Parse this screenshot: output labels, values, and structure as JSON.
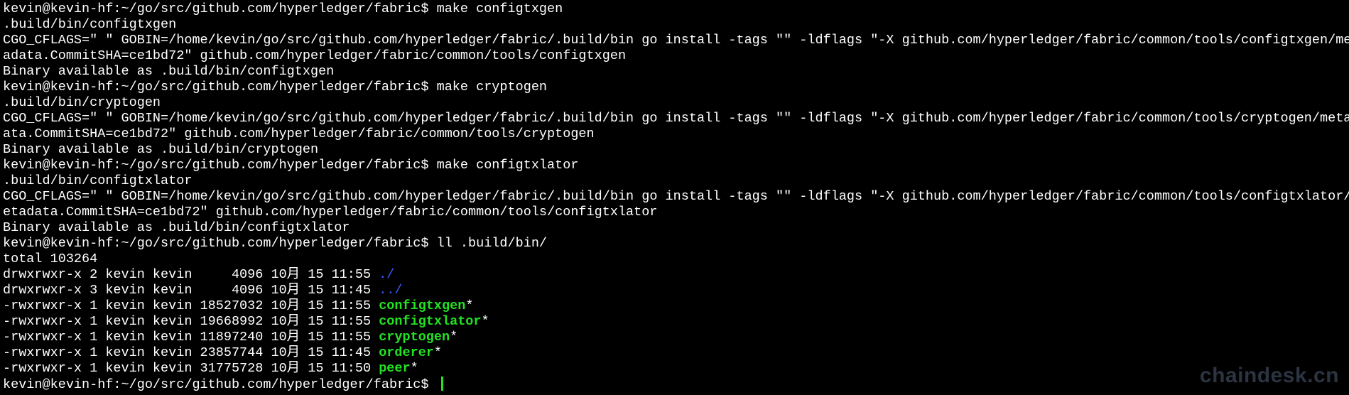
{
  "terminal": {
    "lines": [
      "kevin@kevin-hf:~/go/src/github.com/hyperledger/fabric$ make configtxgen",
      ".build/bin/configtxgen",
      "CGO_CFLAGS=\" \" GOBIN=/home/kevin/go/src/github.com/hyperledger/fabric/.build/bin go install -tags \"\" -ldflags \"-X github.com/hyperledger/fabric/common/tools/configtxgen/met",
      "adata.CommitSHA=ce1bd72\" github.com/hyperledger/fabric/common/tools/configtxgen",
      "Binary available as .build/bin/configtxgen",
      "kevin@kevin-hf:~/go/src/github.com/hyperledger/fabric$ make cryptogen",
      ".build/bin/cryptogen",
      "CGO_CFLAGS=\" \" GOBIN=/home/kevin/go/src/github.com/hyperledger/fabric/.build/bin go install -tags \"\" -ldflags \"-X github.com/hyperledger/fabric/common/tools/cryptogen/metad",
      "ata.CommitSHA=ce1bd72\" github.com/hyperledger/fabric/common/tools/cryptogen",
      "Binary available as .build/bin/cryptogen",
      "kevin@kevin-hf:~/go/src/github.com/hyperledger/fabric$ make configtxlator",
      ".build/bin/configtxlator",
      "CGO_CFLAGS=\" \" GOBIN=/home/kevin/go/src/github.com/hyperledger/fabric/.build/bin go install -tags \"\" -ldflags \"-X github.com/hyperledger/fabric/common/tools/configtxlator/m",
      "etadata.CommitSHA=ce1bd72\" github.com/hyperledger/fabric/common/tools/configtxlator",
      "Binary available as .build/bin/configtxlator",
      "kevin@kevin-hf:~/go/src/github.com/hyperledger/fabric$ ll .build/bin/",
      "total 103264"
    ],
    "listing": [
      {
        "prefix": "drwxrwxr-x 2 kevin kevin     4096 10月 15 11:55 ",
        "name": "./",
        "suffix": "",
        "kind": "dir"
      },
      {
        "prefix": "drwxrwxr-x 3 kevin kevin     4096 10月 15 11:45 ",
        "name": "../",
        "suffix": "",
        "kind": "dir"
      },
      {
        "prefix": "-rwxrwxr-x 1 kevin kevin 18527032 10月 15 11:55 ",
        "name": "configtxgen",
        "suffix": "*",
        "kind": "exe"
      },
      {
        "prefix": "-rwxrwxr-x 1 kevin kevin 19668992 10月 15 11:55 ",
        "name": "configtxlator",
        "suffix": "*",
        "kind": "exe"
      },
      {
        "prefix": "-rwxrwxr-x 1 kevin kevin 11897240 10月 15 11:55 ",
        "name": "cryptogen",
        "suffix": "*",
        "kind": "exe"
      },
      {
        "prefix": "-rwxrwxr-x 1 kevin kevin 23857744 10月 15 11:45 ",
        "name": "orderer",
        "suffix": "*",
        "kind": "exe"
      },
      {
        "prefix": "-rwxrwxr-x 1 kevin kevin 31775728 10月 15 11:50 ",
        "name": "peer",
        "suffix": "*",
        "kind": "exe"
      }
    ],
    "prompt": "kevin@kevin-hf:~/go/src/github.com/hyperledger/fabric$ ",
    "colors": {
      "background": "#000000",
      "text": "#ffffff",
      "directory": "#3b5bff",
      "executable": "#22e322",
      "cursor": "#22e322"
    }
  },
  "watermark": "chaindesk.cn"
}
